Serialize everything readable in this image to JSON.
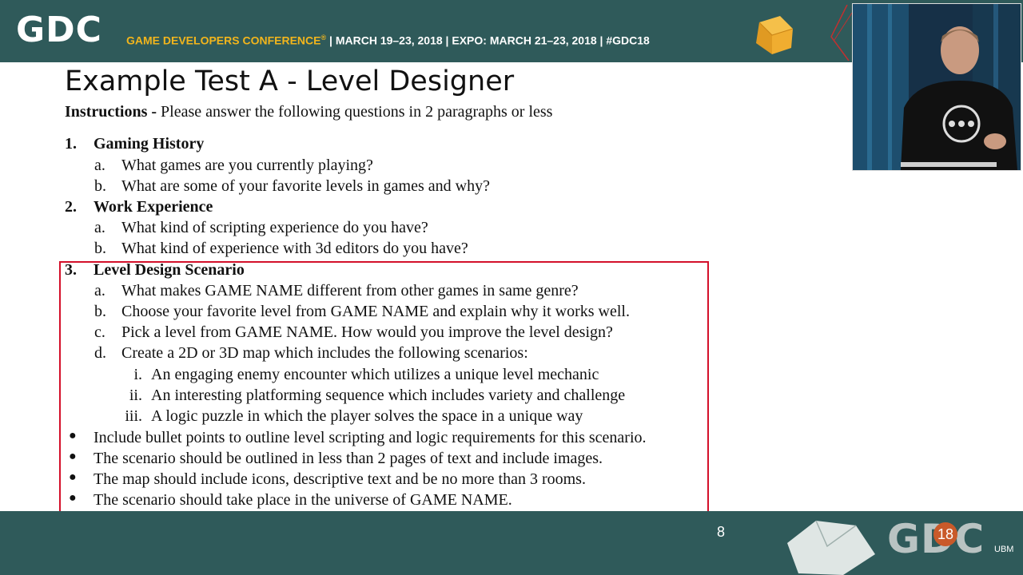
{
  "header": {
    "logo": "GDC",
    "conference": "GAME DEVELOPERS CONFERENCE",
    "trademark": "®",
    "dates": " | MARCH 19–23, 2018 | EXPO: MARCH 21–23, 2018 | #GDC18"
  },
  "slide": {
    "title": "Example Test A - Level Designer",
    "instructions_label": "Instructions -",
    "instructions_text": " Please answer the following questions in 2 paragraphs or less",
    "sections": [
      {
        "number": "1.",
        "heading": "Gaming History",
        "items": [
          {
            "marker": "a.",
            "text": "What games are you currently playing?"
          },
          {
            "marker": "b.",
            "text": "What are some of your favorite levels in games and why?"
          }
        ]
      },
      {
        "number": "2.",
        "heading": "Work Experience",
        "items": [
          {
            "marker": "a.",
            "text": "What kind of scripting experience do you have?"
          },
          {
            "marker": "b.",
            "text": "What kind of experience with 3d editors do you have?"
          }
        ]
      },
      {
        "number": "3.",
        "heading": "Level Design Scenario",
        "items": [
          {
            "marker": "a.",
            "text": "What makes GAME NAME different from other games in same genre?"
          },
          {
            "marker": "b.",
            "text": "Choose your favorite level from GAME NAME and explain why it works well."
          },
          {
            "marker": "c.",
            "text": "Pick a level from GAME NAME. How would you improve the level design?"
          },
          {
            "marker": "d.",
            "text": "Create a 2D or 3D map which includes the following scenarios:"
          }
        ],
        "subitems": [
          {
            "marker": "i.",
            "text": "An engaging enemy encounter which utilizes a unique level mechanic"
          },
          {
            "marker": "ii.",
            "text": "An interesting platforming sequence which includes variety and challenge"
          },
          {
            "marker": "iii.",
            "text": "A logic puzzle in which the player solves the space in a unique way"
          }
        ]
      }
    ],
    "bullets": [
      "Include bullet points to outline level scripting and logic requirements for this scenario.",
      "The scenario should be outlined in less than 2 pages of text and include images.",
      "The map should include icons, descriptive text and be no more than 3 rooms.",
      "The scenario should take place in the universe of GAME NAME."
    ],
    "bullet_marker": "●",
    "page_number": "8"
  },
  "footer": {
    "logo": "GDC",
    "badge": "18",
    "sponsor": "UBM"
  },
  "colors": {
    "banner": "#2f5a5a",
    "accent_yellow": "#f2b51c",
    "highlight_red": "#d4102a"
  }
}
